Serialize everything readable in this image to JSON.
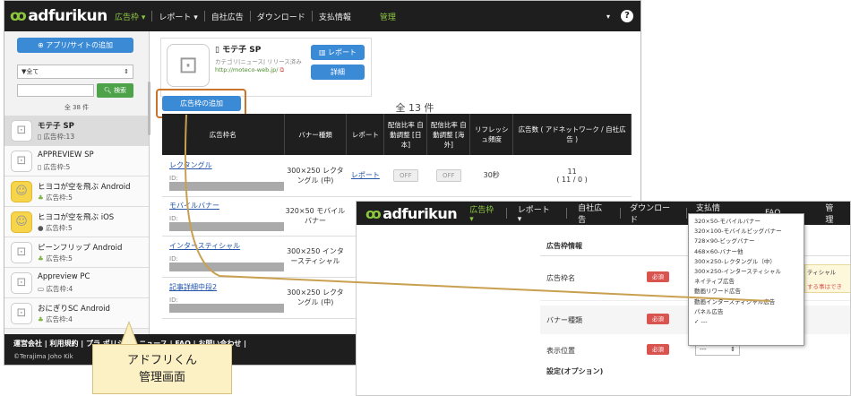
{
  "screen1": {
    "nav": {
      "logo_text": "adfurikun",
      "items": [
        "広告枠 ▾",
        "レポート ▾",
        "自社広告",
        "ダウンロード",
        "支払情報",
        "管理"
      ],
      "right_caret": "▾",
      "help": "?"
    },
    "sidebar": {
      "add_button": "アプリ/サイトの追加",
      "filter_value": "▼全て",
      "search_button": "検索",
      "count": "全 38 件",
      "items": [
        {
          "name": "モテ子 SP",
          "count": "広告枠:13",
          "platform": "ios"
        },
        {
          "name": "APPREVIEW SP",
          "count": "広告枠:5",
          "platform": "ios"
        },
        {
          "name": "ヒヨコが空を飛ぶ Android",
          "count": "広告枠:5",
          "platform": "android"
        },
        {
          "name": "ヒヨコが空を飛ぶ iOS",
          "count": "広告枠:5",
          "platform": "ios"
        },
        {
          "name": "ピーンフリップ Android",
          "count": "広告枠:5",
          "platform": "android"
        },
        {
          "name": "Appreview PC",
          "count": "広告枠:4",
          "platform": "pc"
        },
        {
          "name": "おにぎりSC Android",
          "count": "広告枠:4",
          "platform": "android"
        }
      ]
    },
    "app": {
      "name": "モテ子 SP",
      "category": "カテゴリ|ニュース| リリース済み",
      "url": "http://moteco-web.jp/",
      "report_button": "レポート",
      "detail_button": "詳細"
    },
    "add_slot_button": "広告枠の追加",
    "total": "全 13 件",
    "table": {
      "headers": [
        "広告枠名",
        "バナー種類",
        "レポート",
        "配信比率 自動調整 [日本]",
        "配信比率 自動調整 [海外]",
        "リフレッシュ頻度",
        "広告数 ( アドネットワーク / 自社広告 )"
      ],
      "rows": [
        {
          "name": "レクタングル",
          "id_label": "ID:",
          "banner": "300×250 レクタングル (中)",
          "report": "レポート",
          "jp": "OFF",
          "intl": "OFF",
          "refresh": "30秒",
          "ads": "11",
          "ads_detail": "( 11 / 0 )"
        },
        {
          "name": "モバイルバナー",
          "id_label": "ID:",
          "banner": "320×50 モバイルバナー"
        },
        {
          "name": "インタースティシャル",
          "id_label": "ID:",
          "banner": "300×250 インタースティシャル"
        },
        {
          "name": "記事詳細中段2",
          "id_label": "ID:",
          "banner": "300×250 レクタングル (中)"
        }
      ]
    },
    "footer": {
      "links": "運営会社 | 利用規約 | プラ  ポリシー | ニュース | FAQ | お問い合わせ |",
      "copyright": "©Terajima Joho Kik"
    }
  },
  "screen2": {
    "nav": {
      "logo_text": "adfurikun",
      "items": [
        "広告枠 ▾",
        "レポート ▾",
        "自社広告",
        "ダウンロード",
        "支払情報",
        "FAQ",
        "管理"
      ]
    },
    "section_title": "広告枠情報",
    "fields": [
      {
        "label": "広告枠名",
        "badge": "必須"
      },
      {
        "label": "バナー種類",
        "badge": "必須"
      },
      {
        "label": "表示位置",
        "badge": "必須"
      }
    ],
    "position_select": "---",
    "options_title": "設定(オプション)",
    "side_hint_1": "ティシャル",
    "side_hint_2": "する事はでき",
    "dropdown": [
      "320×50-モバイルバナー",
      "320×100-モバイルビッグバナー",
      "728×90-ビッグバナー",
      "468×60-バナー他",
      "300×250-レクタングル（中）",
      "300×250-インタースティシャル",
      "ネイティブ広告",
      "動画リワード広告",
      "動画インタースティシャル広告",
      "パネル広告",
      "✓ ---"
    ]
  },
  "callout": {
    "line1": "アドフリくん",
    "line2": "管理画面"
  },
  "colors": {
    "nav_bg": "#1e1e1e",
    "accent_blue": "#3a8ad6",
    "logo_green": "#8cc63f",
    "highlight_orange": "#c8742a",
    "required_red": "#d9534f"
  }
}
